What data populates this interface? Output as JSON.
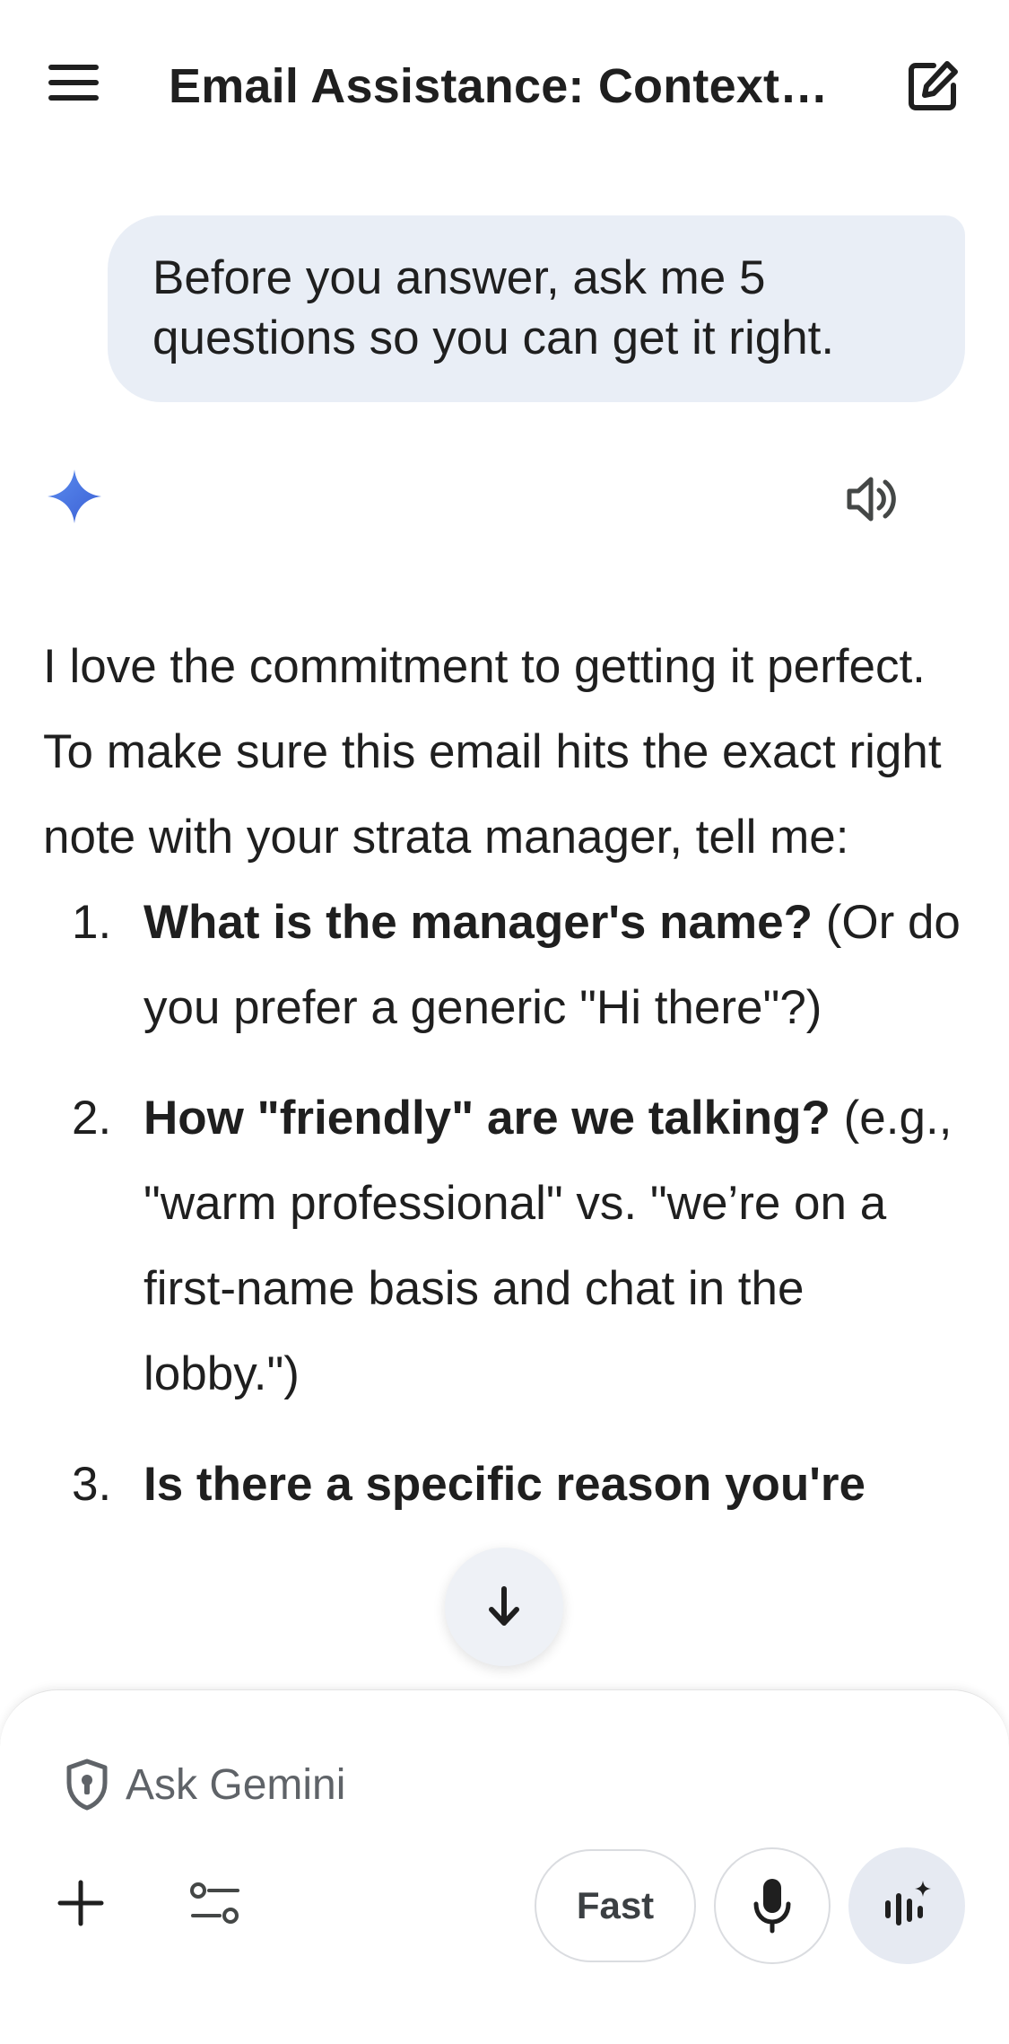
{
  "header": {
    "title": "Email Assistance: Context…",
    "menu_icon": "hamburger-menu-icon",
    "edit_icon": "new-chat-edit-icon"
  },
  "user_message": {
    "text": "Before you answer, ask me 5 questions so you can get it right."
  },
  "assistant": {
    "spark_icon": "gemini-spark-icon",
    "speaker_icon": "speaker-icon",
    "intro": "I love the commitment to getting it perfect. To make sure this email hits the exact right note with your strata manager, tell me:",
    "questions": [
      {
        "number": "1.",
        "bold": "What is the manager's name?",
        "rest": " (Or do you prefer a generic \"Hi there\"?)"
      },
      {
        "number": "2.",
        "bold": "How \"friendly\" are we talking?",
        "rest": " (e.g., \"warm professional\" vs. \"we’re on a first-name basis and chat in the lobby.\")"
      },
      {
        "number": "3.",
        "bold": "Is there a specific reason you're",
        "rest": ""
      }
    ]
  },
  "composer": {
    "placeholder": "Ask Gemini",
    "fast_label": "Fast"
  },
  "colors": {
    "accent_blue": "#4a72e8",
    "bubble_bg": "#e9eef6",
    "text": "#1f1f1f"
  }
}
